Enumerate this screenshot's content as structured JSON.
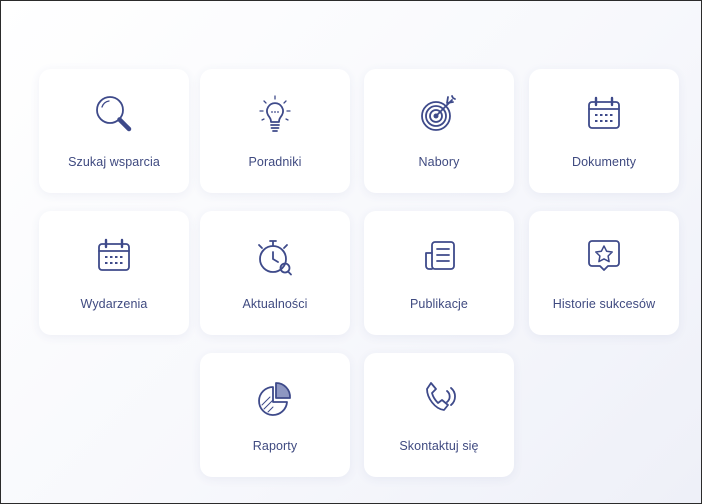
{
  "tiles": [
    {
      "id": "szukaj",
      "label": "Szukaj wsparcia",
      "icon": "search-icon"
    },
    {
      "id": "poradniki",
      "label": "Poradniki",
      "icon": "lightbulb-icon"
    },
    {
      "id": "nabory",
      "label": "Nabory",
      "icon": "target-icon"
    },
    {
      "id": "dokumenty",
      "label": "Dokumenty",
      "icon": "calendar-icon"
    },
    {
      "id": "wydarzenia",
      "label": "Wydarzenia",
      "icon": "calendar-icon"
    },
    {
      "id": "aktualnosci",
      "label": "Aktualności",
      "icon": "stopwatch-icon"
    },
    {
      "id": "publikacje",
      "label": "Publikacje",
      "icon": "document-icon"
    },
    {
      "id": "historie",
      "label": "Historie sukcesów",
      "icon": "star-bubble-icon"
    },
    {
      "id": "raporty",
      "label": "Raporty",
      "icon": "pie-chart-icon"
    },
    {
      "id": "kontakt",
      "label": "Skontaktuj się",
      "icon": "phone-call-icon"
    }
  ],
  "colors": {
    "icon_stroke": "#3e4a8a",
    "label_text": "#3f4a80",
    "tile_bg": "#ffffff"
  }
}
